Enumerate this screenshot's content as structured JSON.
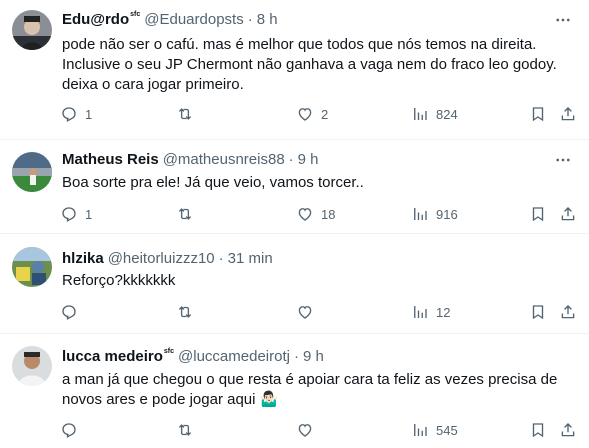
{
  "tweets": [
    {
      "name": "Edu@rdo",
      "badge": "sfc",
      "handle": "@Eduardopsts",
      "time": "8 h",
      "lines": [
        "pode não ser o cafú. mas é melhor que todos que nós temos na direita.",
        "Inclusive o seu JP Chermont não ganhava a vaga nem do fraco leo godoy.",
        "deixa o cara jogar primeiro."
      ],
      "replies": "1",
      "retweets": "",
      "likes": "2",
      "views": "824"
    },
    {
      "name": "Matheus Reis",
      "badge": "",
      "handle": "@matheusnreis88",
      "time": "9 h",
      "lines": [
        "Boa sorte pra ele! Já que veio, vamos torcer.."
      ],
      "replies": "1",
      "retweets": "",
      "likes": "18",
      "views": "916"
    },
    {
      "name": "hlzika",
      "badge": "",
      "handle": "@heitorluizzz10",
      "time": "31 min",
      "lines": [
        "Reforço?kkkkkkk"
      ],
      "replies": "",
      "retweets": "",
      "likes": "",
      "views": "12"
    },
    {
      "name": "lucca medeiro",
      "badge": "sfc",
      "handle": "@luccamedeirotj",
      "time": "9 h",
      "lines": [
        "a man já que chegou o que resta é apoiar cara ta feliz as vezes precisa de",
        "novos ares e pode jogar aqui 🤷🏻‍♂️"
      ],
      "replies": "",
      "retweets": "",
      "likes": "",
      "views": "545"
    }
  ],
  "icons": {
    "reply": "reply-icon",
    "retweet": "retweet-icon",
    "like": "heart-icon",
    "views": "views-icon",
    "bookmark": "bookmark-icon",
    "share": "share-icon",
    "more": "more-icon"
  },
  "colors": {
    "text": "#0f1419",
    "secondary": "#536471",
    "divider": "#eff3f4"
  }
}
